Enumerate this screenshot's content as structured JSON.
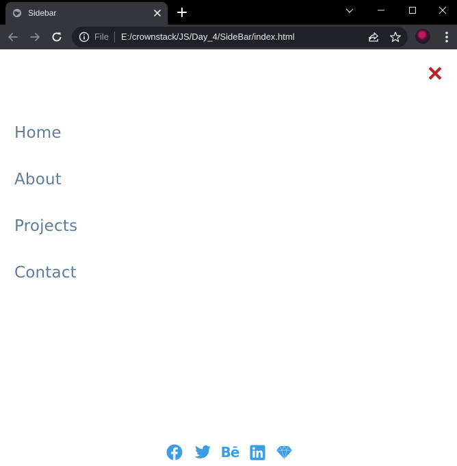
{
  "browser": {
    "tab": {
      "title": "Sidebar"
    },
    "address_bar": {
      "scheme_label": "File",
      "url": "E:/crownstack/JS/Day_4/SideBar/index.html"
    }
  },
  "page": {
    "close_button": {
      "icon": "close-icon",
      "color": "#b5262a"
    },
    "nav": {
      "color": "#5f7d9c",
      "items": [
        {
          "label": "Home"
        },
        {
          "label": "About"
        },
        {
          "label": "Projects"
        },
        {
          "label": "Contact"
        }
      ]
    },
    "socials": {
      "color": "#3d9de3",
      "items": [
        {
          "icon": "facebook-icon"
        },
        {
          "icon": "twitter-icon"
        },
        {
          "icon": "behance-icon",
          "text": "Bē"
        },
        {
          "icon": "linkedin-icon"
        },
        {
          "icon": "sketch-icon"
        }
      ]
    }
  }
}
